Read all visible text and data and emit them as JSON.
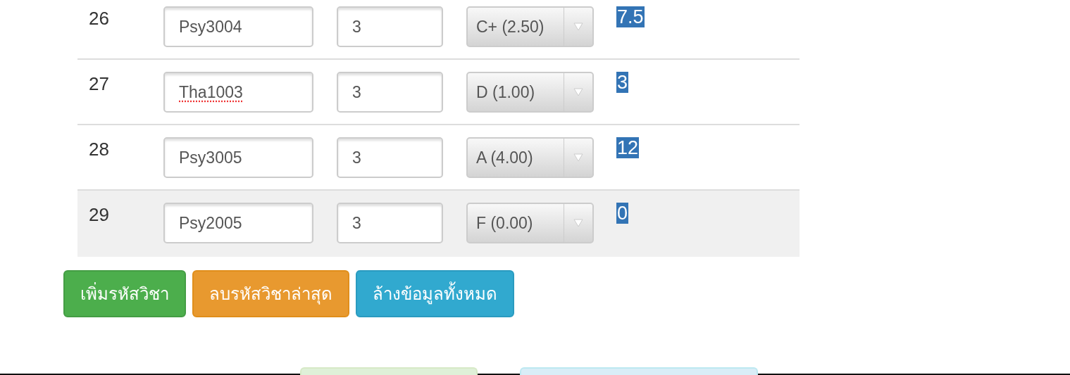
{
  "rows": [
    {
      "number": "26",
      "course": "Psy3004",
      "credit": "3",
      "grade": "C+ (2.50)",
      "points": "7.5",
      "hovered": false,
      "spell_error": false
    },
    {
      "number": "27",
      "course": "Tha1003",
      "credit": "3",
      "grade": "D (1.00)",
      "points": "3",
      "hovered": false,
      "spell_error": true
    },
    {
      "number": "28",
      "course": "Psy3005",
      "credit": "3",
      "grade": "A (4.00)",
      "points": "12",
      "hovered": false,
      "spell_error": false
    },
    {
      "number": "29",
      "course": "Psy2005",
      "credit": "3",
      "grade": "F (0.00)",
      "points": "0",
      "hovered": true,
      "spell_error": false
    }
  ],
  "buttons": [
    {
      "label": "เพิ่มรหัสวิชา",
      "kind": "success"
    },
    {
      "label": "ลบรหัสวิชาล่าสุด",
      "kind": "warning"
    },
    {
      "label": "ล้างข้อมูลทั้งหมด",
      "kind": "info"
    }
  ]
}
